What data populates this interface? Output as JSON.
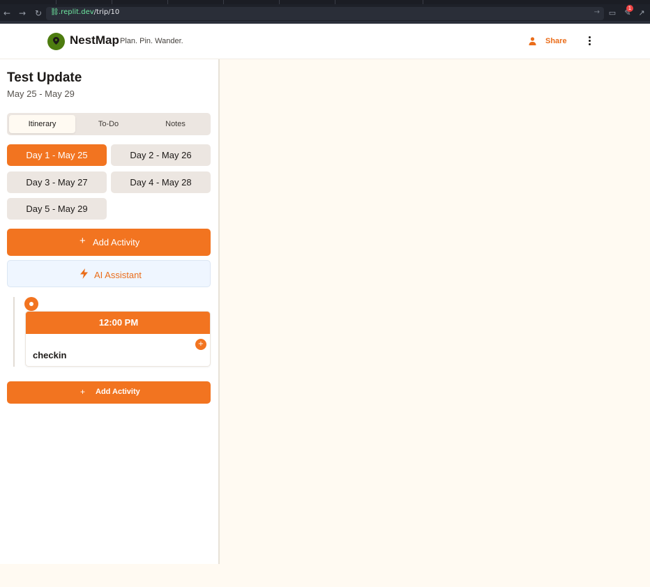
{
  "browser": {
    "url_host": ".replit.dev",
    "url_path": "/trip/10",
    "badge_count": "1"
  },
  "header": {
    "brand_name": "NestMap",
    "tagline": "Plan. Pin. Wander.",
    "share_label": "Share"
  },
  "trip": {
    "title": "Test Update",
    "dates": "May 25 - May 29"
  },
  "tabs": [
    {
      "label": "Itinerary",
      "active": true
    },
    {
      "label": "To-Do",
      "active": false
    },
    {
      "label": "Notes",
      "active": false
    }
  ],
  "days": [
    {
      "label": "Day 1 - May 25",
      "active": true
    },
    {
      "label": "Day 2 - May 26",
      "active": false
    },
    {
      "label": "Day 3 - May 27",
      "active": false
    },
    {
      "label": "Day 4 - May 28",
      "active": false
    },
    {
      "label": "Day 5 - May 29",
      "active": false
    }
  ],
  "actions": {
    "add_activity_label": "Add Activity",
    "ai_assistant_label": "AI Assistant",
    "add_activity_bottom_label": "Add Activity",
    "plus_glyph": "+"
  },
  "activities": [
    {
      "time": "12:00 PM",
      "name": "checkin"
    }
  ],
  "colors": {
    "accent": "#f27420",
    "brand_green": "#4d7c0f",
    "ai_bg": "#eff6ff"
  }
}
